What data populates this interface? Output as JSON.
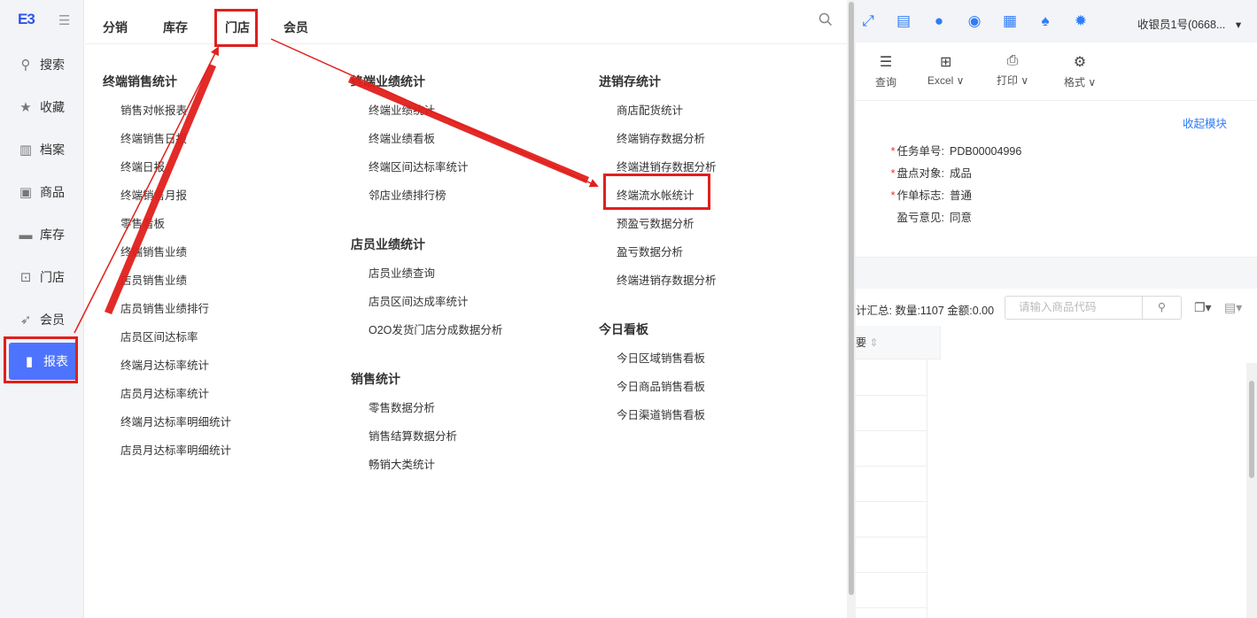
{
  "sidebar": {
    "logo": "E3",
    "collapse_icon": "menu-fold-icon",
    "items": [
      {
        "label": "搜索",
        "icon": "search-icon"
      },
      {
        "label": "收藏",
        "icon": "star-icon"
      },
      {
        "label": "档案",
        "icon": "books-icon"
      },
      {
        "label": "商品",
        "icon": "inbox-icon"
      },
      {
        "label": "库存",
        "icon": "box-icon"
      },
      {
        "label": "门店",
        "icon": "store-icon"
      },
      {
        "label": "会员",
        "icon": "rocket-icon"
      },
      {
        "label": "报表",
        "icon": "bar-chart-icon"
      }
    ]
  },
  "menu": {
    "tabs": [
      "分销",
      "库存",
      "门店",
      "会员"
    ],
    "columns": [
      {
        "groups": [
          {
            "title": "终端销售统计",
            "items": [
              "销售对帐报表",
              "终端销售日报",
              "终端日报",
              "终端销售月报",
              "零售看板",
              "终端销售业绩",
              "店员销售业绩",
              "店员销售业绩排行",
              "店员区间达标率",
              "终端月达标率统计",
              "店员月达标率统计",
              "终端月达标率明细统计",
              "店员月达标率明细统计"
            ]
          }
        ]
      },
      {
        "groups": [
          {
            "title": "终端业绩统计",
            "items": [
              "终端业绩统计",
              "终端业绩看板",
              "终端区间达标率统计",
              "邻店业绩排行榜"
            ]
          },
          {
            "title": "店员业绩统计",
            "items": [
              "店员业绩查询",
              "店员区间达成率统计",
              "O2O发货门店分成数据分析"
            ]
          },
          {
            "title": "销售统计",
            "items": [
              "零售数据分析",
              "销售结算数据分析",
              "畅销大类统计"
            ]
          }
        ]
      },
      {
        "groups": [
          {
            "title": "进销存统计",
            "items": [
              "商店配货统计",
              "终端销存数据分析",
              "终端进销存数据分析",
              "终端流水帐统计",
              "预盈亏数据分析",
              "盈亏数据分析",
              "终端进销存数据分析"
            ]
          },
          {
            "title": "今日看板",
            "items": [
              "今日区域销售看板",
              "今日商品销售看板",
              "今日渠道销售看板"
            ]
          }
        ]
      }
    ]
  },
  "app": {
    "user": "收银员1号(0668...",
    "toolbar": [
      {
        "label": "查询",
        "icon": "query-icon"
      },
      {
        "label": "Excel ∨",
        "icon": "table-icon"
      },
      {
        "label": "打印 ∨",
        "icon": "print-icon"
      },
      {
        "label": "格式 ∨",
        "icon": "gear-icon"
      }
    ],
    "collapse_link": "收起模块",
    "fields": [
      {
        "label": "任务单号:",
        "value": "PDB00004996",
        "required": true
      },
      {
        "label": "盘点对象:",
        "value": "成品",
        "required": true
      },
      {
        "label": "作单标志:",
        "value": "普通",
        "required": true
      },
      {
        "label": "盈亏意见:",
        "value": "同意",
        "required": false
      }
    ],
    "summary": "计汇总:  数量:1107 金额:0.00",
    "code_placeholder": "请输入商品代码",
    "grid_header": "要"
  }
}
